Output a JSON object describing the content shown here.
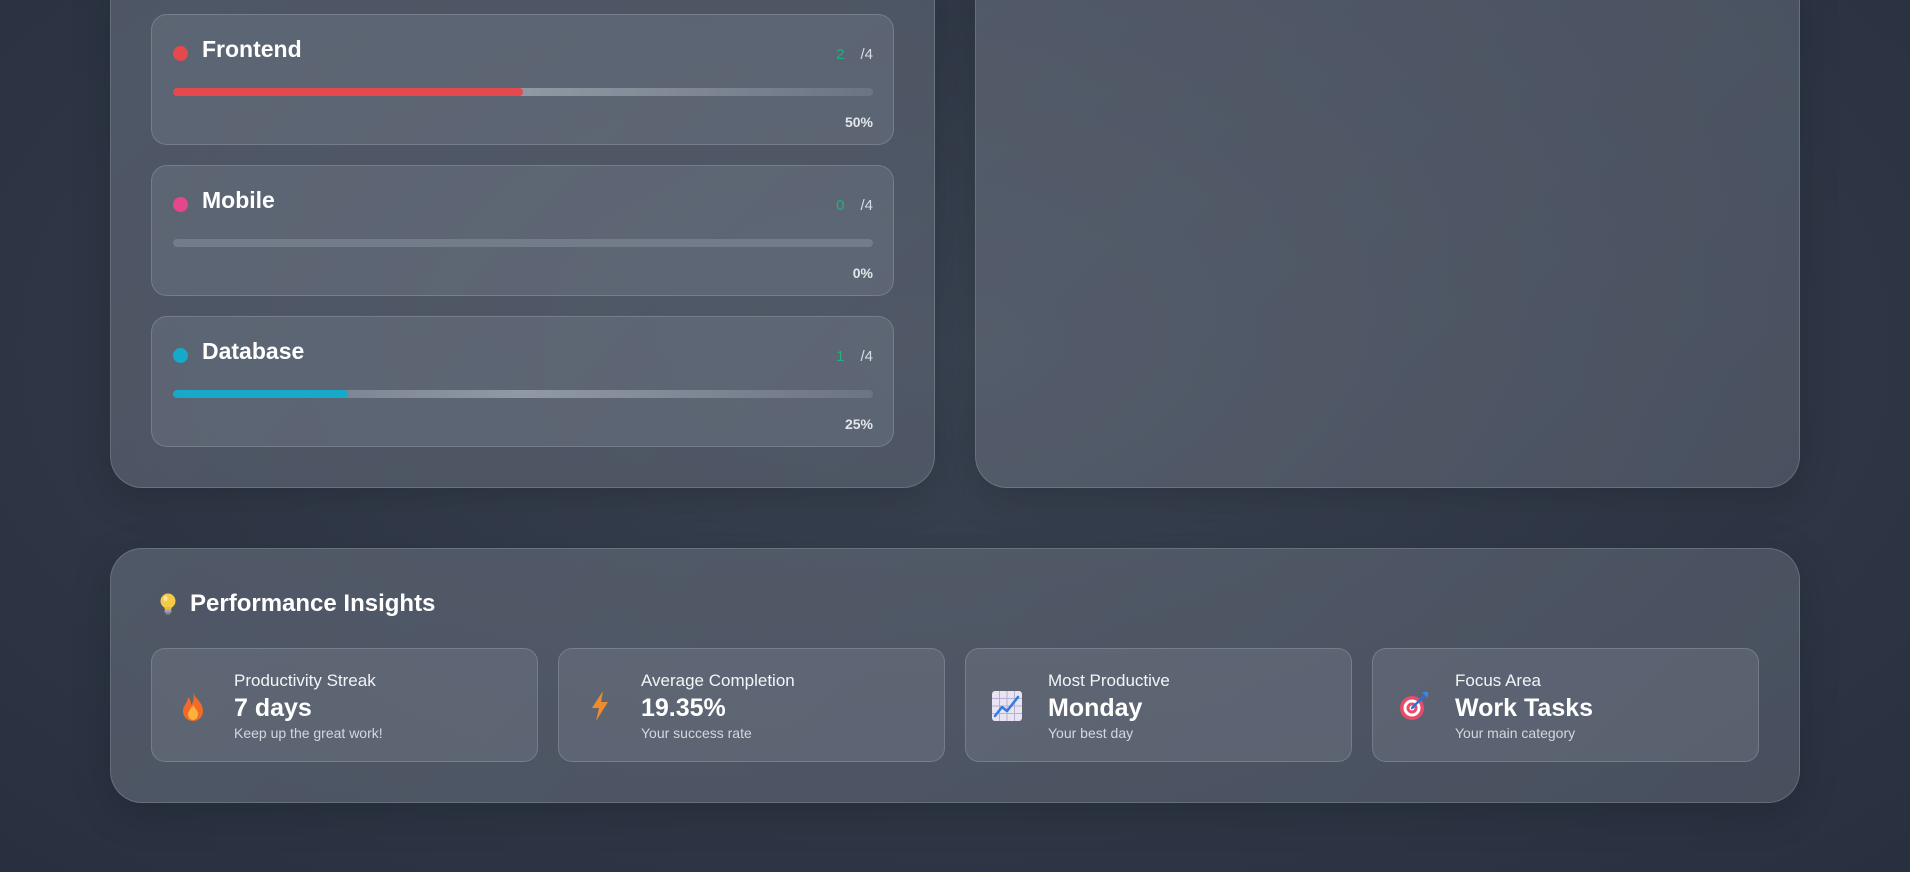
{
  "categories": [
    {
      "name": "Frontend",
      "done": "2",
      "total": "/4",
      "percent": "50%",
      "progress": 0.5,
      "color": "#e5484d"
    },
    {
      "name": "Mobile",
      "done": "0",
      "total": "/4",
      "percent": "0%",
      "progress": 0.0,
      "color": "#e5478c"
    },
    {
      "name": "Database",
      "done": "1",
      "total": "/4",
      "percent": "25%",
      "progress": 0.25,
      "color": "#17a9c9"
    }
  ],
  "insights": {
    "title": "Performance Insights",
    "icon": "lightbulb-icon",
    "cards": [
      {
        "label": "Productivity Streak",
        "value": "7 days",
        "sub": "Keep up the great work!",
        "icon": "fire-icon"
      },
      {
        "label": "Average Completion",
        "value": "19.35%",
        "sub": "Your success rate",
        "icon": "lightning-icon"
      },
      {
        "label": "Most Productive",
        "value": "Monday",
        "sub": "Your best day",
        "icon": "chart-increasing-icon"
      },
      {
        "label": "Focus Area",
        "value": "Work Tasks",
        "sub": "Your main category",
        "icon": "target-icon"
      }
    ]
  },
  "colors": {
    "done_count": "#22b07d"
  }
}
